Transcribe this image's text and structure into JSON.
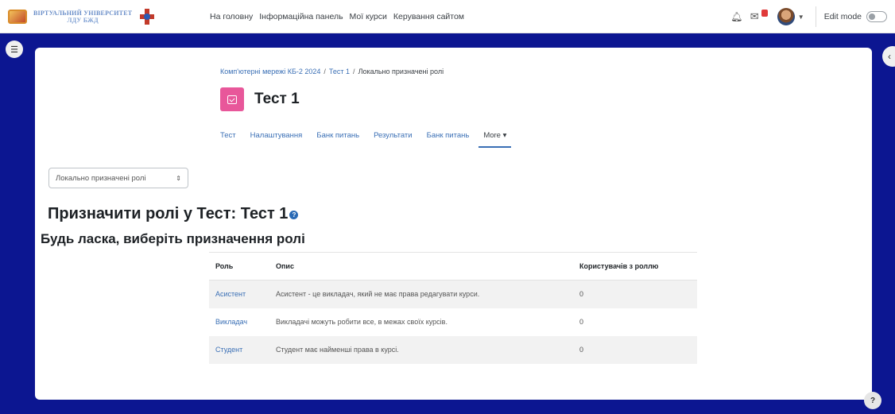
{
  "nav": {
    "logo_line1": "ВІРТУАЛЬНИЙ УНІВЕРСИТЕТ",
    "logo_line2": "ЛДУ БЖД",
    "links": [
      "На головну",
      "Інформаційна панель",
      "Мої курси",
      "Керування сайтом"
    ],
    "edit_mode_label": "Edit mode",
    "edit_mode_on": false
  },
  "breadcrumb": {
    "course": "Комп'ютерні мережі КБ-2 2024",
    "activity": "Тест 1",
    "current": "Локально призначені ролі"
  },
  "page_title": "Тест 1",
  "tabs": [
    "Тест",
    "Налаштування",
    "Банк питань",
    "Результати",
    "Банк питань",
    "More ▾"
  ],
  "role_select": {
    "value": "Локально призначені ролі"
  },
  "heading": "Призначити ролі у Тест: Тест 1",
  "subheading": "Будь ласка, виберіть призначення ролі",
  "table": {
    "headers": [
      "Роль",
      "Опис",
      "Користувачів з роллю"
    ],
    "rows": [
      {
        "role": "Асистент",
        "description": "Асистент - це викладач, який не має права редагувати курси.",
        "count": "0"
      },
      {
        "role": "Викладач",
        "description": "Викладачі можуть робити все, в межах своїх курсів.",
        "count": "0"
      },
      {
        "role": "Студент",
        "description": "Студент має найменші права в курсі.",
        "count": "0"
      }
    ]
  },
  "colors": {
    "frame_blue": "#0c1691",
    "link_blue": "#3a6fb5",
    "quiz_pink": "#e8579a"
  }
}
